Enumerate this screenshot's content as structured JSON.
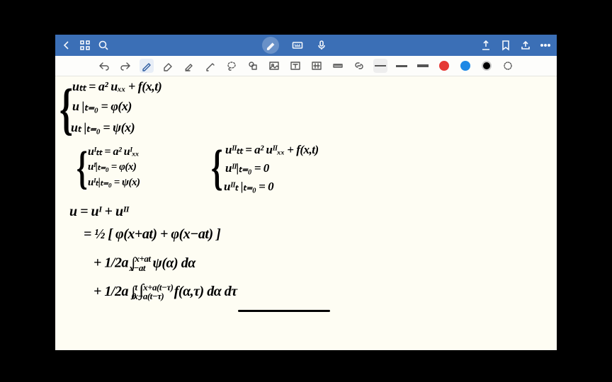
{
  "titlebar": {
    "back_icon": "back",
    "apps_icon": "apps",
    "search_icon": "search",
    "pen_mode_icon": "pen",
    "keyboard_icon": "keyboard",
    "mic_icon": "mic",
    "export_icon": "export",
    "bookmark_icon": "bookmark",
    "share_icon": "share",
    "more_icon": "more"
  },
  "toolbar": {
    "undo_icon": "undo",
    "redo_icon": "redo",
    "pen_icon": "pen",
    "eraser_icon": "eraser",
    "highlighter_icon": "highlighter",
    "pencil_icon": "pencil",
    "lasso_icon": "lasso",
    "shape_icon": "shape",
    "image_icon": "image",
    "text_icon": "text",
    "attach_icon": "attach",
    "ruler_icon": "ruler",
    "link_icon": "link",
    "color_red": "#e53935",
    "color_blue": "#1e88e5",
    "color_black": "#000000"
  },
  "notes": {
    "brace1": "{",
    "l1": "uₜₜ = a² uₓₓ + f(x,t)",
    "l2": "u |ₜ₌₀ = φ(x)",
    "l3": "uₜ |ₜ₌₀ = ψ(x)",
    "brace2": "{",
    "l4": "uᴵₜₜ = a² uᴵₓₓ",
    "l5": "uᴵ|ₜ₌₀ = φ(x)",
    "l6": "uᴵₜ|ₜ₌₀ = ψ(x)",
    "brace3": "{",
    "l7": "uᴵᴵₜₜ = a² uᴵᴵₓₓ + f(x,t)",
    "l8": "uᴵᴵ|ₜ₌₀ = 0",
    "l9": "uᴵᴵₜ |ₜ₌₀ = 0",
    "l10": "u = uᴵ + uᴵᴵ",
    "l11": "= ½ [ φ(x+at) + φ(x−at) ]",
    "l12a": "+ 1/2a ∫",
    "l12sup": "x+at",
    "l12sub": "x−at",
    "l12b": "ψ(α) dα",
    "l13a": "+ 1/2a ∫",
    "l13sup1": "t",
    "l13sub1": "0",
    "l13mid": "∫",
    "l13sup2": "x+a(t−τ)",
    "l13sub2": "x−a(t−τ)",
    "l13b": "f(α,τ) dα dτ"
  }
}
